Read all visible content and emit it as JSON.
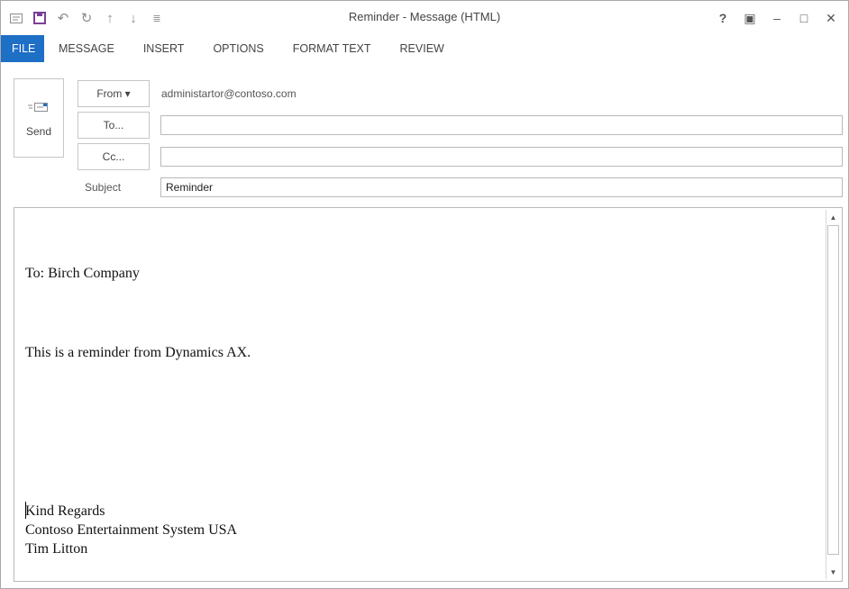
{
  "window": {
    "title": "Reminder - Message (HTML)"
  },
  "quick_access": [
    {
      "name": "mail-icon",
      "glyph": "✉"
    },
    {
      "name": "save-icon",
      "glyph": "💾"
    },
    {
      "name": "undo-icon",
      "glyph": "↶"
    },
    {
      "name": "redo-icon",
      "glyph": "↻"
    },
    {
      "name": "up-arrow-icon",
      "glyph": "↑"
    },
    {
      "name": "down-arrow-icon",
      "glyph": "↓"
    },
    {
      "name": "customize-icon",
      "glyph": "≣"
    }
  ],
  "window_controls": {
    "help": "?",
    "ribbon_display": "▣",
    "minimize": "–",
    "maximize": "□",
    "close": "✕"
  },
  "tabs": [
    "FILE",
    "MESSAGE",
    "INSERT",
    "OPTIONS",
    "FORMAT TEXT",
    "REVIEW"
  ],
  "header": {
    "send_label": "Send",
    "from_label": "From ▾",
    "from_address": "administartor@contoso.com",
    "to_label": "To...",
    "to_value": "",
    "cc_label": "Cc...",
    "cc_value": "",
    "subject_label": "Subject",
    "subject_value": "Reminder"
  },
  "body": {
    "lines": [
      "To: Birch Company",
      "This is a reminder from Dynamics AX.",
      "Kind Regards",
      "Contoso Entertainment System USA",
      "Tim Litton"
    ]
  },
  "colors": {
    "accent": "#1e6fc6"
  }
}
